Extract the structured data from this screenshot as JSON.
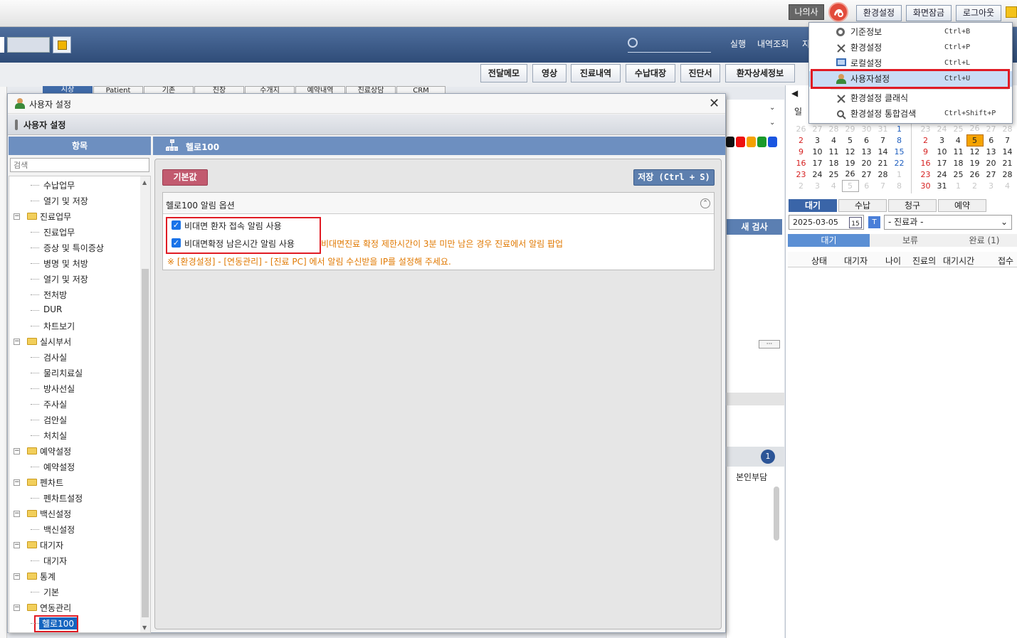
{
  "topbar": {
    "my_info": "나의사",
    "settings": "환경설정",
    "lock": "화면잠금",
    "logout": "로그아웃"
  },
  "nav": {
    "run": "실행",
    "history": "내역조회",
    "more": "지"
  },
  "toolbar": [
    "전달메모",
    "영상",
    "진료내역",
    "수납대장",
    "진단서",
    "환자상세정보"
  ],
  "background_tabs": [
    "시상",
    "Patient",
    "기존",
    "진장",
    "수개지",
    "예약내역",
    "진료상담",
    "CRM"
  ],
  "menu": {
    "items": [
      {
        "label": "기준정보",
        "shortcut": "Ctrl+B",
        "icon": "gear-icon"
      },
      {
        "label": "환경설정",
        "shortcut": "Ctrl+P",
        "icon": "tools-icon"
      },
      {
        "label": "로컬설정",
        "shortcut": "Ctrl+L",
        "icon": "monitor-icon"
      },
      {
        "label": "사용자설정",
        "shortcut": "Ctrl+U",
        "icon": "user-icon"
      },
      {
        "label": "환경설정 클래식",
        "shortcut": "",
        "icon": "tools-icon"
      },
      {
        "label": "환경설정 통합검색",
        "shortcut": "Ctrl+Shift+P",
        "icon": "search-icon"
      }
    ]
  },
  "dialog": {
    "title": "사용자 설정",
    "header": "사용자 설정",
    "left_header": "항목",
    "search_placeholder": "검색",
    "right_header": "헬로100",
    "default_button": "기본값",
    "save_button": "저장 (Ctrl + S)",
    "section_title": "헬로100 알림 옵션",
    "option1": "비대면 환자 접속 알림 사용",
    "option2": "비대면확정 남은시간 알림 사용",
    "option2_desc": "비대면진료 확정 제한시간이 3분 미만 남은 경우 진료에서 알림 팝업",
    "note": "※ [환경설정] - [연동관리] - [진료 PC] 에서 알림 수신받을 IP를 설정해 주세요."
  },
  "tree": [
    {
      "label": "수납업무",
      "level": 2
    },
    {
      "label": "열기 및 저장",
      "level": 2
    },
    {
      "label": "진료업무",
      "level": 1
    },
    {
      "label": "진료업무",
      "level": 2
    },
    {
      "label": "증상 및 특이증상",
      "level": 2
    },
    {
      "label": "병명 및 처방",
      "level": 2
    },
    {
      "label": "열기 및 저장",
      "level": 2
    },
    {
      "label": "전처방",
      "level": 2
    },
    {
      "label": "DUR",
      "level": 2
    },
    {
      "label": "차트보기",
      "level": 2
    },
    {
      "label": "실시부서",
      "level": 1
    },
    {
      "label": "검사실",
      "level": 2
    },
    {
      "label": "물리치료실",
      "level": 2
    },
    {
      "label": "방사선실",
      "level": 2
    },
    {
      "label": "주사실",
      "level": 2
    },
    {
      "label": "검안실",
      "level": 2
    },
    {
      "label": "처치실",
      "level": 2
    },
    {
      "label": "예약설정",
      "level": 1
    },
    {
      "label": "예약설정",
      "level": 2
    },
    {
      "label": "펜차트",
      "level": 1
    },
    {
      "label": "펜차트설정",
      "level": 2
    },
    {
      "label": "백신설정",
      "level": 1
    },
    {
      "label": "백신설정",
      "level": 2
    },
    {
      "label": "대기자",
      "level": 1
    },
    {
      "label": "대기자",
      "level": 2
    },
    {
      "label": "통계",
      "level": 1
    },
    {
      "label": "기본",
      "level": 2
    },
    {
      "label": "연동관리",
      "level": 1
    },
    {
      "label": "헬로100",
      "level": 2
    }
  ],
  "calendar": {
    "dow_first": "일",
    "left_rows": [
      [
        "26",
        "27",
        "28",
        "29",
        "30",
        "31",
        "1"
      ],
      [
        "2",
        "3",
        "4",
        "5",
        "6",
        "7",
        "8"
      ],
      [
        "9",
        "10",
        "11",
        "12",
        "13",
        "14",
        "15"
      ],
      [
        "16",
        "17",
        "18",
        "19",
        "20",
        "21",
        "22"
      ],
      [
        "23",
        "24",
        "25",
        "26",
        "27",
        "28",
        "1"
      ],
      [
        "2",
        "3",
        "4",
        "5",
        "6",
        "7",
        "8"
      ]
    ],
    "right_rows": [
      [
        "23",
        "24",
        "25",
        "26",
        "27",
        "28"
      ],
      [
        "2",
        "3",
        "4",
        "5",
        "6",
        "7"
      ],
      [
        "9",
        "10",
        "11",
        "12",
        "13",
        "14"
      ],
      [
        "16",
        "17",
        "18",
        "19",
        "20",
        "21"
      ],
      [
        "23",
        "24",
        "25",
        "26",
        "27",
        "28"
      ],
      [
        "30",
        "31",
        "1",
        "2",
        "3",
        "4"
      ]
    ]
  },
  "right_panel": {
    "tabs": [
      "대기",
      "수납",
      "청구",
      "예약"
    ],
    "date": "2025-03-05",
    "date_icon": "15",
    "t_badge": "T",
    "dept": "- 진료과 -",
    "subtabs": [
      "대기",
      "보류",
      "완료 (1)"
    ],
    "columns": [
      "상태",
      "대기자",
      "나이",
      "진료의",
      "대기시간",
      "접수"
    ]
  },
  "mid": {
    "new_exam": "새 검사",
    "dots": "···",
    "badge": "1",
    "self_pay": "본인부담"
  }
}
